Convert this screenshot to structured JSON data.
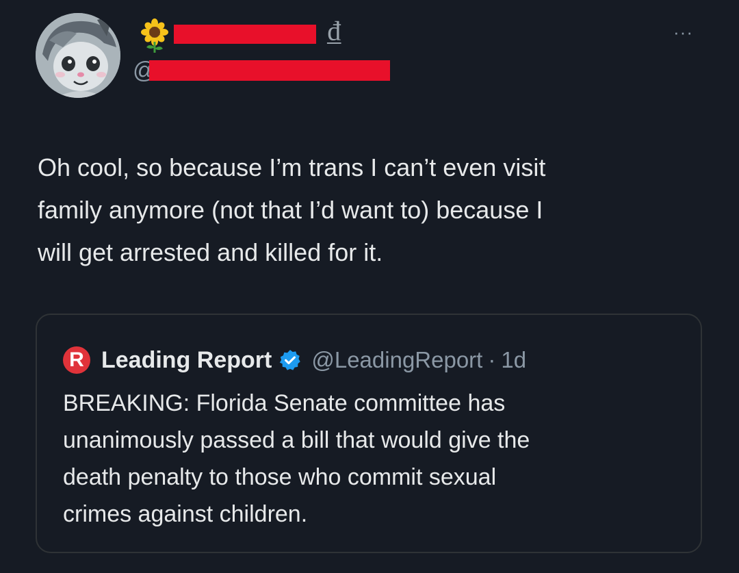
{
  "tweet": {
    "avatar_icon": "furry-character-avatar",
    "display_name_emoji": "sunflower-icon",
    "display_name_trailing_glyph": "₫",
    "handle_prefix": "@",
    "more_label": "···",
    "text": "Oh cool, so because I’m trans I can’t even visit\nfamily anymore (not that I’d want to) because I\nwill get arrested and killed for it."
  },
  "quoted_tweet": {
    "logo_letter": "R",
    "display_name": "Leading Report",
    "verified_icon": "verified-badge-icon",
    "handle": "@LeadingReport",
    "separator": "·",
    "time": "1d",
    "text": "BREAKING: Florida Senate committee has\nunanimously passed a bill that would give the\ndeath penalty to those who commit sexual\ncrimes against children."
  },
  "colors": {
    "background": "#161b24",
    "redaction": "#e8102a",
    "verified": "#1d9bf0",
    "logo": "#e0333a"
  }
}
